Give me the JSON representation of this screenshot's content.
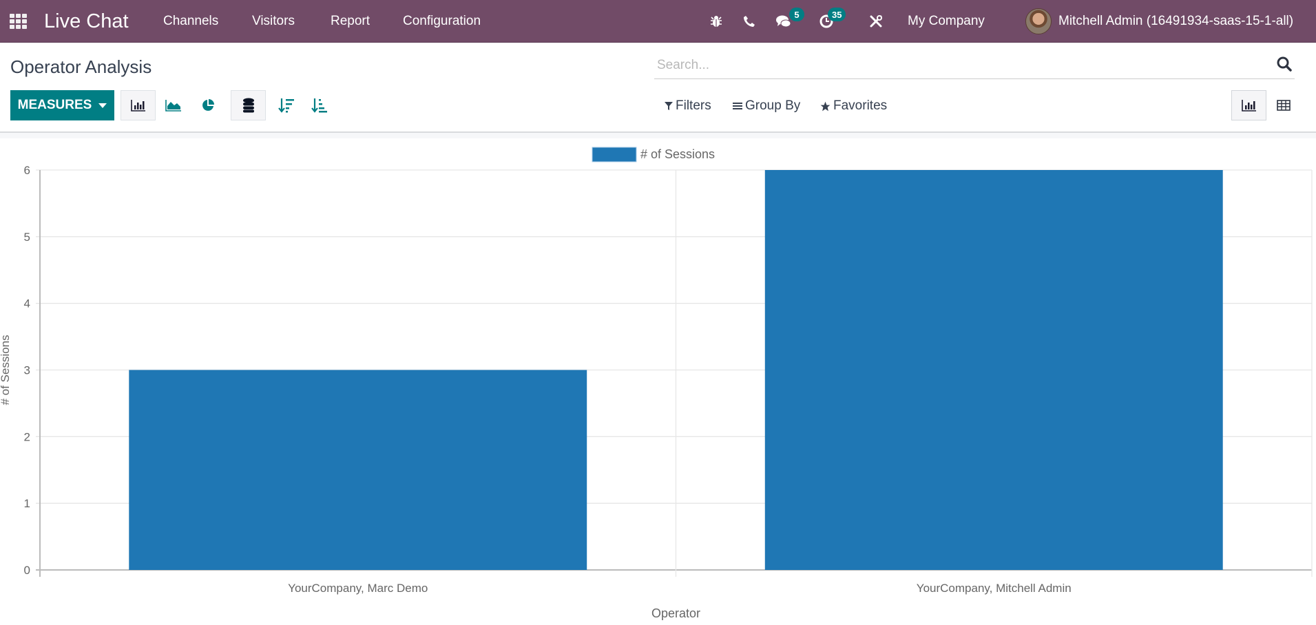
{
  "navbar": {
    "app_title": "Live Chat",
    "menu": [
      "Channels",
      "Visitors",
      "Report",
      "Configuration"
    ],
    "icons": [
      "bug-icon",
      "phone-icon",
      "chat-icon",
      "clock-icon",
      "tools-icon"
    ],
    "messages_badge": "5",
    "activities_badge": "35",
    "company": "My Company",
    "user": "Mitchell Admin (16491934-saas-15-1-all)"
  },
  "control_panel": {
    "title": "Operator Analysis",
    "measures_label": "MEASURES",
    "search_placeholder": "Search...",
    "filters_label": "Filters",
    "group_by_label": "Group By",
    "favorites_label": "Favorites",
    "graph_modes": [
      "bar",
      "line",
      "pie"
    ],
    "active_mode": "bar",
    "stacked": true,
    "views": [
      "graph",
      "pivot"
    ],
    "active_view": "graph"
  },
  "colors": {
    "navbar": "#714B67",
    "primary": "#017e84",
    "bar": "#1f77b4"
  },
  "chart_data": {
    "type": "bar",
    "title": "",
    "categories": [
      "YourCompany, Marc Demo",
      "YourCompany, Mitchell Admin"
    ],
    "series": [
      {
        "name": "# of Sessions",
        "values": [
          3,
          6
        ]
      }
    ],
    "xlabel": "Operator",
    "ylabel": "# of Sessions",
    "ylim": [
      0,
      6
    ],
    "yticks": [
      0,
      1,
      2,
      3,
      4,
      5,
      6
    ],
    "grid": true,
    "legend": "top-center"
  }
}
